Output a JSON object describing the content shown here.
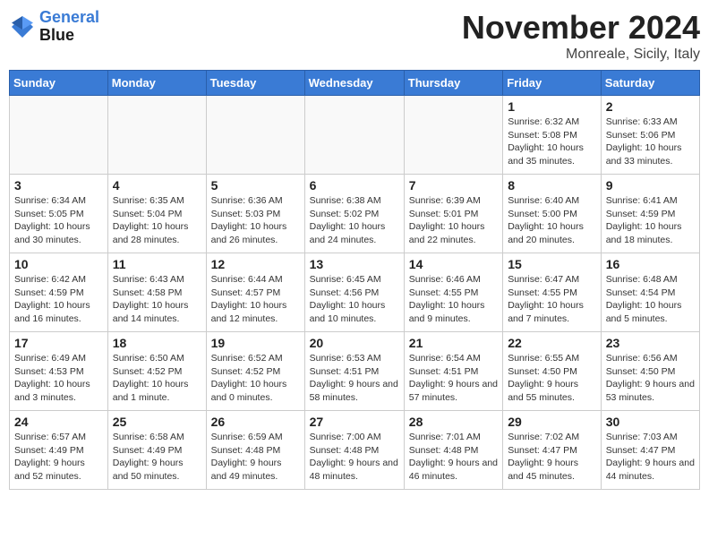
{
  "header": {
    "logo_line1": "General",
    "logo_line2": "Blue",
    "month_title": "November 2024",
    "location": "Monreale, Sicily, Italy"
  },
  "weekdays": [
    "Sunday",
    "Monday",
    "Tuesday",
    "Wednesday",
    "Thursday",
    "Friday",
    "Saturday"
  ],
  "weeks": [
    [
      {
        "day": "",
        "info": ""
      },
      {
        "day": "",
        "info": ""
      },
      {
        "day": "",
        "info": ""
      },
      {
        "day": "",
        "info": ""
      },
      {
        "day": "",
        "info": ""
      },
      {
        "day": "1",
        "info": "Sunrise: 6:32 AM\nSunset: 5:08 PM\nDaylight: 10 hours and 35 minutes."
      },
      {
        "day": "2",
        "info": "Sunrise: 6:33 AM\nSunset: 5:06 PM\nDaylight: 10 hours and 33 minutes."
      }
    ],
    [
      {
        "day": "3",
        "info": "Sunrise: 6:34 AM\nSunset: 5:05 PM\nDaylight: 10 hours and 30 minutes."
      },
      {
        "day": "4",
        "info": "Sunrise: 6:35 AM\nSunset: 5:04 PM\nDaylight: 10 hours and 28 minutes."
      },
      {
        "day": "5",
        "info": "Sunrise: 6:36 AM\nSunset: 5:03 PM\nDaylight: 10 hours and 26 minutes."
      },
      {
        "day": "6",
        "info": "Sunrise: 6:38 AM\nSunset: 5:02 PM\nDaylight: 10 hours and 24 minutes."
      },
      {
        "day": "7",
        "info": "Sunrise: 6:39 AM\nSunset: 5:01 PM\nDaylight: 10 hours and 22 minutes."
      },
      {
        "day": "8",
        "info": "Sunrise: 6:40 AM\nSunset: 5:00 PM\nDaylight: 10 hours and 20 minutes."
      },
      {
        "day": "9",
        "info": "Sunrise: 6:41 AM\nSunset: 4:59 PM\nDaylight: 10 hours and 18 minutes."
      }
    ],
    [
      {
        "day": "10",
        "info": "Sunrise: 6:42 AM\nSunset: 4:59 PM\nDaylight: 10 hours and 16 minutes."
      },
      {
        "day": "11",
        "info": "Sunrise: 6:43 AM\nSunset: 4:58 PM\nDaylight: 10 hours and 14 minutes."
      },
      {
        "day": "12",
        "info": "Sunrise: 6:44 AM\nSunset: 4:57 PM\nDaylight: 10 hours and 12 minutes."
      },
      {
        "day": "13",
        "info": "Sunrise: 6:45 AM\nSunset: 4:56 PM\nDaylight: 10 hours and 10 minutes."
      },
      {
        "day": "14",
        "info": "Sunrise: 6:46 AM\nSunset: 4:55 PM\nDaylight: 10 hours and 9 minutes."
      },
      {
        "day": "15",
        "info": "Sunrise: 6:47 AM\nSunset: 4:55 PM\nDaylight: 10 hours and 7 minutes."
      },
      {
        "day": "16",
        "info": "Sunrise: 6:48 AM\nSunset: 4:54 PM\nDaylight: 10 hours and 5 minutes."
      }
    ],
    [
      {
        "day": "17",
        "info": "Sunrise: 6:49 AM\nSunset: 4:53 PM\nDaylight: 10 hours and 3 minutes."
      },
      {
        "day": "18",
        "info": "Sunrise: 6:50 AM\nSunset: 4:52 PM\nDaylight: 10 hours and 1 minute."
      },
      {
        "day": "19",
        "info": "Sunrise: 6:52 AM\nSunset: 4:52 PM\nDaylight: 10 hours and 0 minutes."
      },
      {
        "day": "20",
        "info": "Sunrise: 6:53 AM\nSunset: 4:51 PM\nDaylight: 9 hours and 58 minutes."
      },
      {
        "day": "21",
        "info": "Sunrise: 6:54 AM\nSunset: 4:51 PM\nDaylight: 9 hours and 57 minutes."
      },
      {
        "day": "22",
        "info": "Sunrise: 6:55 AM\nSunset: 4:50 PM\nDaylight: 9 hours and 55 minutes."
      },
      {
        "day": "23",
        "info": "Sunrise: 6:56 AM\nSunset: 4:50 PM\nDaylight: 9 hours and 53 minutes."
      }
    ],
    [
      {
        "day": "24",
        "info": "Sunrise: 6:57 AM\nSunset: 4:49 PM\nDaylight: 9 hours and 52 minutes."
      },
      {
        "day": "25",
        "info": "Sunrise: 6:58 AM\nSunset: 4:49 PM\nDaylight: 9 hours and 50 minutes."
      },
      {
        "day": "26",
        "info": "Sunrise: 6:59 AM\nSunset: 4:48 PM\nDaylight: 9 hours and 49 minutes."
      },
      {
        "day": "27",
        "info": "Sunrise: 7:00 AM\nSunset: 4:48 PM\nDaylight: 9 hours and 48 minutes."
      },
      {
        "day": "28",
        "info": "Sunrise: 7:01 AM\nSunset: 4:48 PM\nDaylight: 9 hours and 46 minutes."
      },
      {
        "day": "29",
        "info": "Sunrise: 7:02 AM\nSunset: 4:47 PM\nDaylight: 9 hours and 45 minutes."
      },
      {
        "day": "30",
        "info": "Sunrise: 7:03 AM\nSunset: 4:47 PM\nDaylight: 9 hours and 44 minutes."
      }
    ]
  ]
}
